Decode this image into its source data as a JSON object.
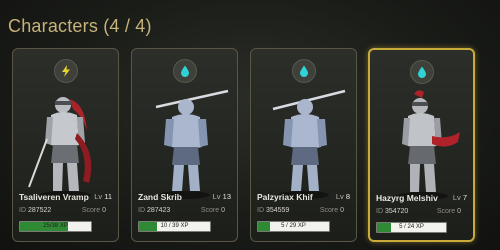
{
  "header": {
    "title": "Characters (4 / 4)"
  },
  "colors": {
    "accent": "#c7b27a",
    "selected_border": "#c9aa3b",
    "xp_fill": "#2f8a35"
  },
  "characters": [
    {
      "name": "Tsaliveren Vramp",
      "level_label": "Lv",
      "level": "11",
      "id_label": "ID",
      "id": "287522",
      "score_label": "Score",
      "score": "0",
      "xp_text": "25/38 XP",
      "xp_fraction": 0.68,
      "badge_icon": "lightning-icon",
      "badge_color": "#e8d42e",
      "selected": false
    },
    {
      "name": "Zand Skrib",
      "level_label": "Lv",
      "level": "13",
      "id_label": "ID",
      "id": "287423",
      "score_label": "Score",
      "score": "0",
      "xp_text": "10 / 39 XP",
      "xp_fraction": 0.26,
      "badge_icon": "water-drop-icon",
      "badge_color": "#2fd2d6",
      "selected": false
    },
    {
      "name": "Palzyriax Khif",
      "level_label": "Lv",
      "level": "8",
      "id_label": "ID",
      "id": "354559",
      "score_label": "Score",
      "score": "0",
      "xp_text": "5 / 29 XP",
      "xp_fraction": 0.17,
      "badge_icon": "water-drop-icon",
      "badge_color": "#2fd2d6",
      "selected": false
    },
    {
      "name": "Hazyrg Melshiv",
      "level_label": "Lv",
      "level": "7",
      "id_label": "ID",
      "id": "354720",
      "score_label": "Score",
      "score": "0",
      "xp_text": "5 / 24 XP",
      "xp_fraction": 0.21,
      "badge_icon": "water-drop-icon",
      "badge_color": "#2fd2d6",
      "selected": true
    }
  ]
}
